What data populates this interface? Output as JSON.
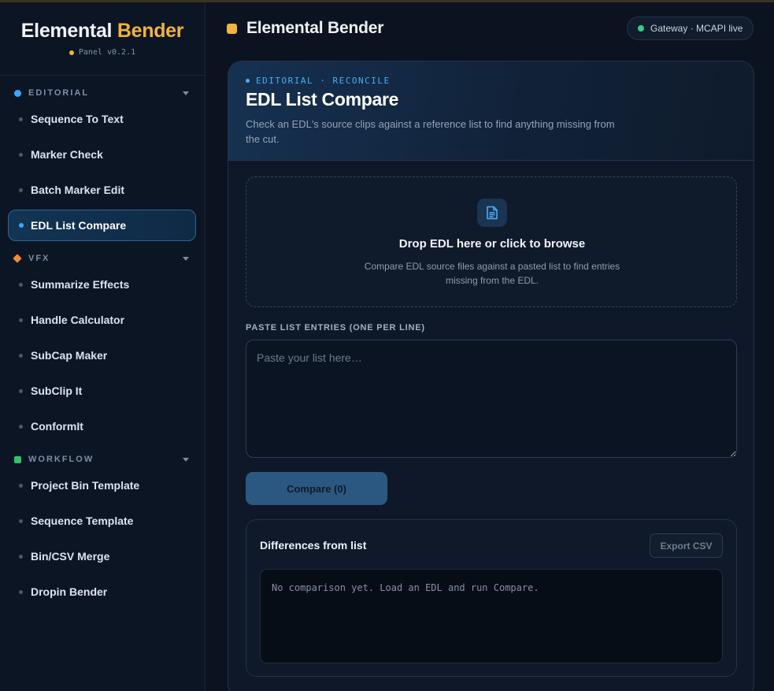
{
  "app": {
    "brand_primary": "Elemental",
    "brand_accent": "Bender",
    "version": "Panel v0.2.1",
    "accent_color": "#f2b33d"
  },
  "header": {
    "title": "Elemental Bender",
    "gateway_status": "Gateway · MCAPI live",
    "gateway_color": "#2fd08a"
  },
  "sidebar": {
    "sections": [
      {
        "label": "EDITORIAL",
        "color": "#3ba5ff",
        "items": [
          "Sequence To Text",
          "Marker Check",
          "Batch Marker Edit",
          "EDL List Compare"
        ]
      },
      {
        "label": "VFX",
        "color": "#f08a3c",
        "items": [
          "Summarize Effects",
          "Handle Calculator",
          "SubCap Maker",
          "SubClip It",
          "ConformIt"
        ]
      },
      {
        "label": "WORKFLOW",
        "color": "#2fc46a",
        "items": [
          "Project Bin Template",
          "Sequence Template",
          "Bin/CSV Merge",
          "Dropin Bender"
        ]
      }
    ],
    "active_item": "EDL List Compare"
  },
  "panel": {
    "kicker": "EDITORIAL · RECONCILE",
    "title": "EDL List Compare",
    "description": "Check an EDL's source clips against a reference list to find anything missing from the cut.",
    "dropzone": {
      "icon": "document-icon",
      "title": "Drop EDL here or click to browse",
      "description": "Compare EDL source files against a pasted list to find entries missing from the EDL."
    },
    "list_label": "PASTE LIST ENTRIES (ONE PER LINE)",
    "list_placeholder": "Paste your list here…",
    "list_value": "",
    "compare_label": "Compare (0)",
    "results": {
      "title": "Differences from list",
      "export_label": "Export CSV",
      "empty_message": "No comparison yet. Load an EDL and run Compare."
    }
  }
}
